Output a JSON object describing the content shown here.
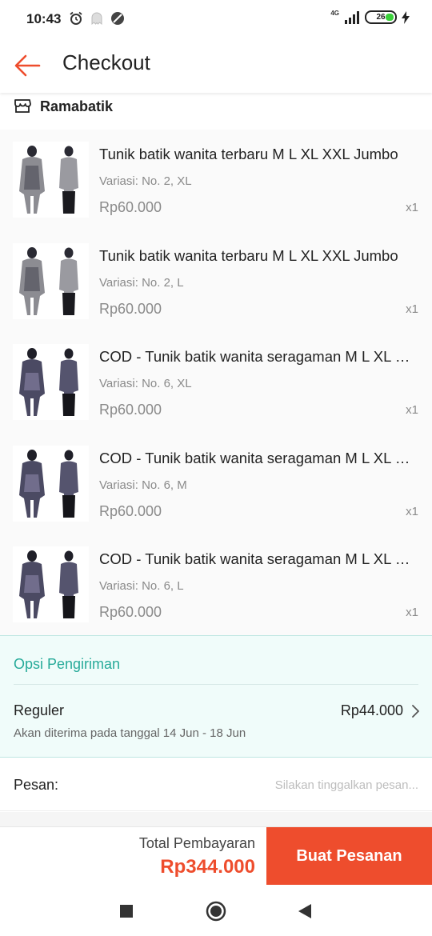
{
  "status_bar": {
    "time": "10:43",
    "network": "4G",
    "battery": "26"
  },
  "app_bar": {
    "title": "Checkout",
    "back_icon": "arrow-left-icon",
    "accent": "#ee4d2d"
  },
  "shop": {
    "icon": "store-icon",
    "name": "Ramabatik"
  },
  "products": [
    {
      "name": "Tunik batik wanita terbaru M L XL XXL Jumbo",
      "variant": "Variasi: No. 2, XL",
      "price": "Rp60.000",
      "qty": "x1"
    },
    {
      "name": "Tunik batik wanita terbaru M L XL XXL Jumbo",
      "variant": "Variasi: No. 2, L",
      "price": "Rp60.000",
      "qty": "x1"
    },
    {
      "name": "COD - Tunik batik wanita seragaman M L XL XXL Jumbo",
      "variant": "Variasi: No. 6, XL",
      "price": "Rp60.000",
      "qty": "x1"
    },
    {
      "name": "COD - Tunik batik wanita seragaman M L XL XXL Jumbo",
      "variant": "Variasi: No. 6, M",
      "price": "Rp60.000",
      "qty": "x1"
    },
    {
      "name": "COD - Tunik batik wanita seragaman M L XL XXL Jumbo",
      "variant": "Variasi: No. 6, L",
      "price": "Rp60.000",
      "qty": "x1"
    }
  ],
  "shipping": {
    "title": "Opsi Pengiriman",
    "method": "Reguler",
    "price": "Rp44.000",
    "eta": "Akan diterima pada tanggal 14 Jun - 18 Jun",
    "color": "#26aa99"
  },
  "message": {
    "label": "Pesan:",
    "placeholder": "Silakan tinggalkan pesan..."
  },
  "footer": {
    "total_label": "Total Pembayaran",
    "total_value": "Rp344.000",
    "order_button": "Buat Pesanan"
  },
  "nav": {
    "recents_icon": "square-icon",
    "home_icon": "circle-icon",
    "back_icon": "triangle-back-icon"
  }
}
